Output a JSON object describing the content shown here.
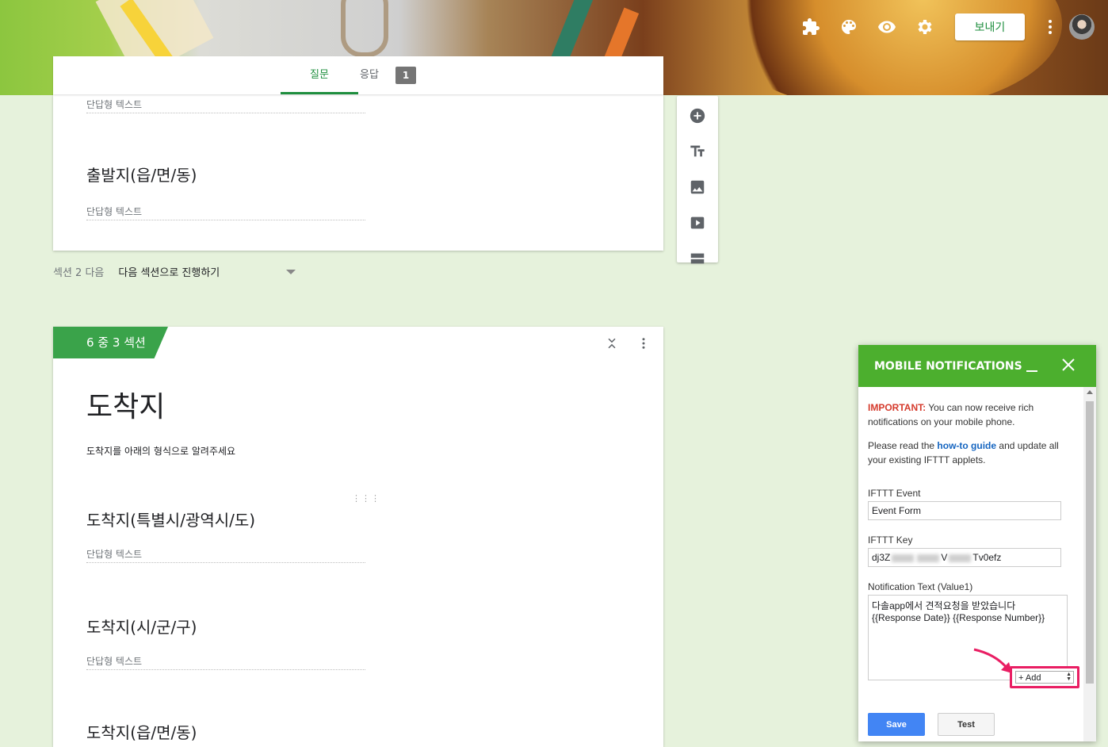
{
  "toolbar": {
    "send_label": "보내기",
    "icons": [
      "puzzle-icon",
      "palette-icon",
      "eye-icon",
      "gear-icon",
      "more-vert-icon"
    ]
  },
  "tabs": {
    "questions": "질문",
    "responses": "응답",
    "responses_count": "1"
  },
  "section2": {
    "items": [
      {
        "title": "",
        "answer_placeholder": "단답형 텍스트"
      },
      {
        "title": "출발지(읍/면/동)",
        "answer_placeholder": "단답형 텍스트"
      }
    ],
    "after_label": "섹션 2 다음",
    "after_value": "다음 섹션으로 진행하기"
  },
  "section3": {
    "tag": "6 중 3 섹션",
    "title": "도착지",
    "description": "도착지를 아래의 형식으로 알려주세요",
    "items": [
      {
        "title": "도착지(특별시/광역시/도)",
        "answer_placeholder": "단답형 텍스트"
      },
      {
        "title": "도착지(시/군/구)",
        "answer_placeholder": "단답형 텍스트"
      },
      {
        "title": "도착지(읍/면/동)",
        "answer_placeholder": ""
      }
    ]
  },
  "sidebar_tools": [
    "add-question-icon",
    "title-text-icon",
    "image-icon",
    "video-icon",
    "section-icon"
  ],
  "panel": {
    "title": "MOBILE NOTIFICATIONS",
    "important_label": "IMPORTANT:",
    "important_text": " You can now receive rich notifications on your mobile phone.",
    "guide_pre": "Please read the ",
    "guide_link": "how-to guide",
    "guide_post": " and update all your existing IFTTT applets.",
    "event_label": "IFTTT Event",
    "event_value": "Event Form",
    "key_label": "IFTTT Key",
    "key_start": "dj3Z",
    "key_mid": "V",
    "key_end": "Tv0efz",
    "text_label": "Notification Text (Value1)",
    "text_value": "다솔app에서 견적요청을 받았습니다\n{{Response Date}} {{Response Number}}",
    "add_label": "+ Add",
    "save_label": "Save",
    "test_label": "Test"
  },
  "colors": {
    "brand_green": "#1e8e3e",
    "section_tag": "#3aa34a",
    "panel_header": "#4caf2e",
    "annotation": "#e91e63",
    "save_blue": "#4285f4",
    "important_red": "#d53a2c"
  }
}
